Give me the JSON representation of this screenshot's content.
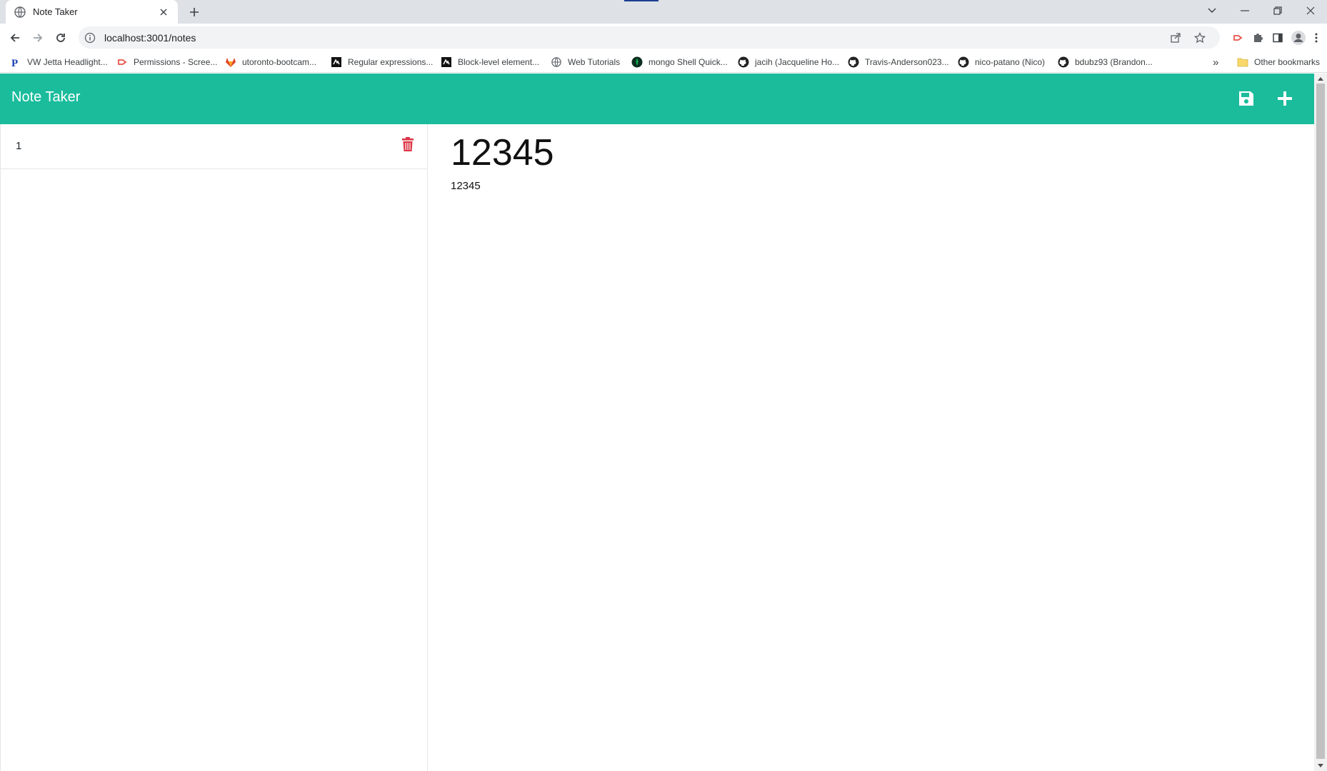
{
  "browser": {
    "tab": {
      "title": "Note Taker"
    },
    "url": "localhost:3001/notes",
    "bookmarks": [
      "VW Jetta Headlight...",
      "Permissions - Scree...",
      "utoronto-bootcam...",
      "Regular expressions...",
      "Block-level element...",
      "Web Tutorials",
      "mongo Shell Quick...",
      "jacih (Jacqueline Ho...",
      "Travis-Anderson023...",
      "nico-patano (Nico)",
      "bdubz93 (Brandon..."
    ],
    "other_bookmarks": "Other bookmarks",
    "overflow": "»"
  },
  "app": {
    "brand": "Note Taker",
    "accent_color": "#1abc9c",
    "delete_color": "#dc3545"
  },
  "notes": [
    {
      "title": "1"
    }
  ],
  "editor": {
    "title_value": "12345",
    "text_value": "12345"
  }
}
